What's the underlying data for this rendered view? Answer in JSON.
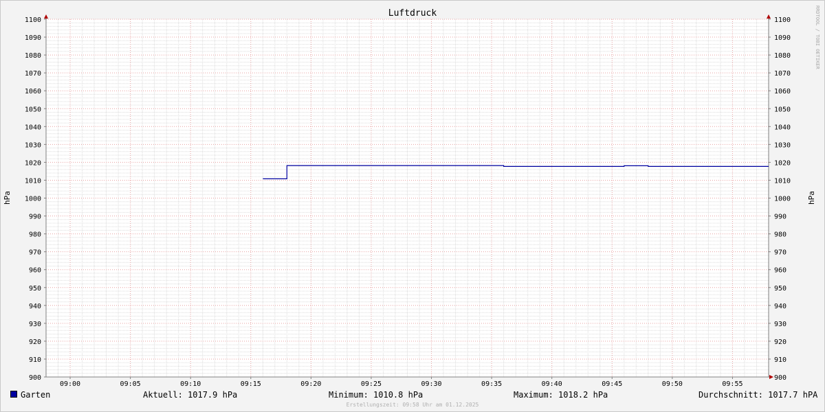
{
  "chart_data": {
    "type": "line",
    "title": "Luftdruck",
    "ylabel": "hPa",
    "ylabel_right": "hPa",
    "ylim": [
      900,
      1100
    ],
    "xlim": [
      "08:58",
      "09:58"
    ],
    "y_ticks": [
      900,
      910,
      920,
      930,
      940,
      950,
      960,
      970,
      980,
      990,
      1000,
      1010,
      1020,
      1030,
      1040,
      1050,
      1060,
      1070,
      1080,
      1090,
      1100
    ],
    "x_ticks": [
      "09:00",
      "09:05",
      "09:10",
      "09:15",
      "09:20",
      "09:25",
      "09:30",
      "09:35",
      "09:40",
      "09:45",
      "09:50",
      "09:55"
    ],
    "grid": true,
    "series": [
      {
        "name": "Garten",
        "color": "#0000a0",
        "points": [
          [
            "09:16",
            1010.8
          ],
          [
            "09:18",
            1010.8
          ],
          [
            "09:18",
            1018.2
          ],
          [
            "09:36",
            1018.2
          ],
          [
            "09:36",
            1017.7
          ],
          [
            "09:46",
            1017.7
          ],
          [
            "09:46",
            1018.1
          ],
          [
            "09:48",
            1018.1
          ],
          [
            "09:48",
            1017.7
          ],
          [
            "09:58",
            1017.7
          ]
        ]
      }
    ]
  },
  "legend": {
    "series_name": "Garten",
    "current": "Aktuell: 1017.9 hPa",
    "minimum": "Minimum: 1010.8 hPa",
    "maximum": "Maximum: 1018.2 hPa",
    "average": "Durchschnitt: 1017.7 hPA"
  },
  "footer": "Erstellungszeit: 09:58 Uhr am 01.12.2025",
  "watermark": "RRDTOOL / TOBI OETIKER"
}
